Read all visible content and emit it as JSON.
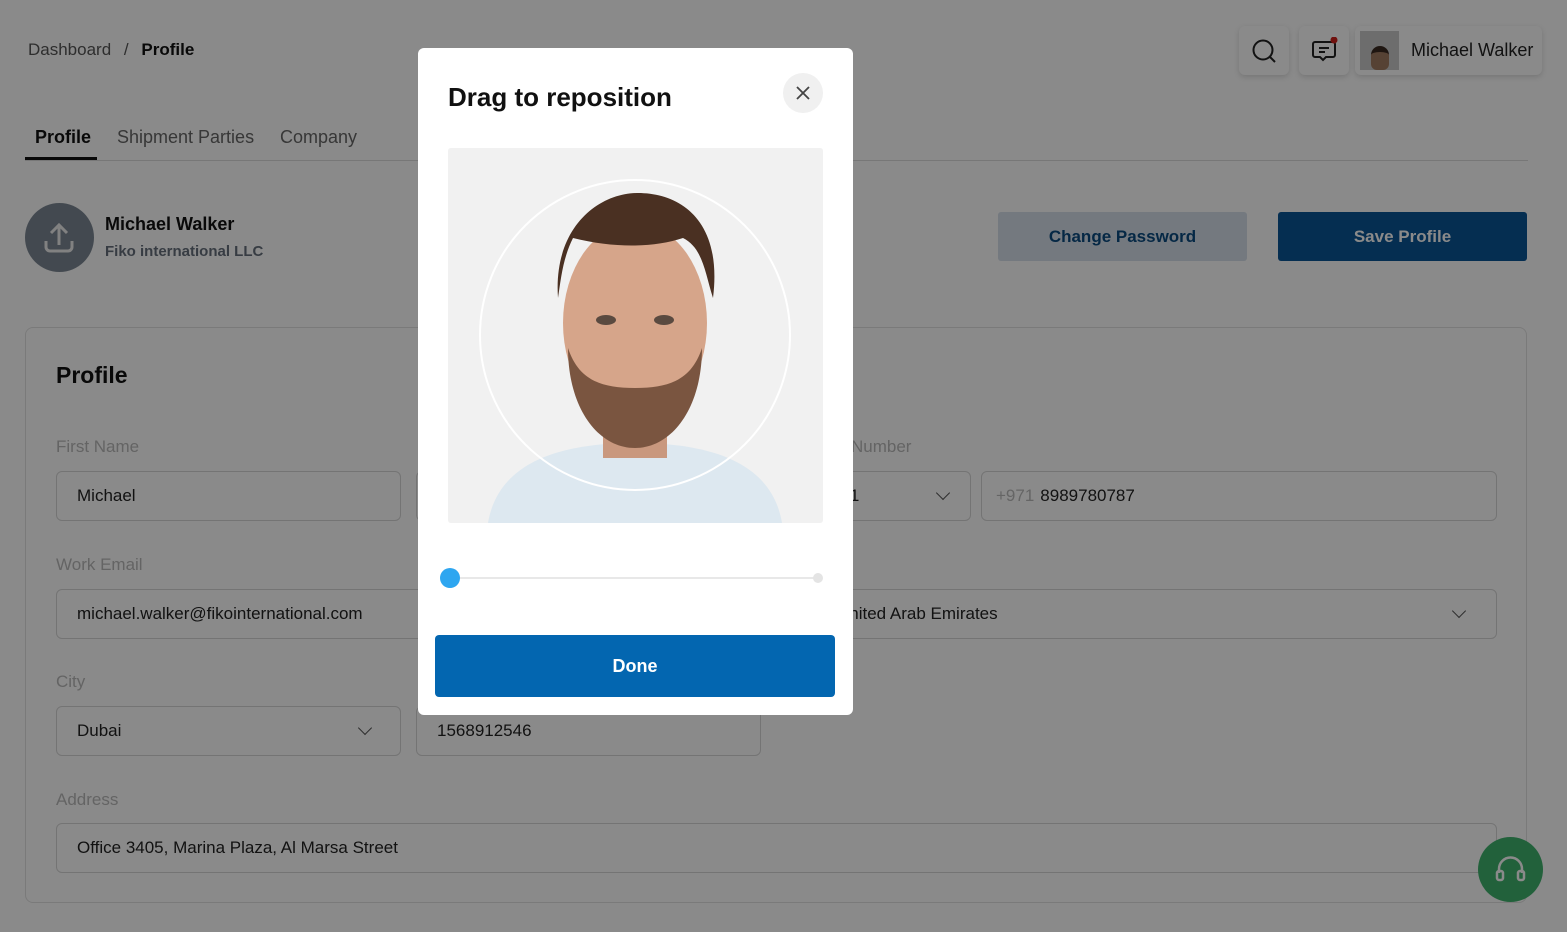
{
  "breadcrumb": {
    "parent": "Dashboard",
    "separator": "/",
    "current": "Profile"
  },
  "header": {
    "user_name": "Michael Walker",
    "notification_dot_color": "#d0201a"
  },
  "tabs": [
    {
      "label": "Profile",
      "active": true
    },
    {
      "label": "Shipment Parties"
    },
    {
      "label": "Company"
    }
  ],
  "profile_summary": {
    "name": "Michael Walker",
    "company": "Fiko international LLC"
  },
  "actions": {
    "change_password": "Change Password",
    "save_profile": "Save Profile"
  },
  "form": {
    "title": "Profile",
    "first_name": {
      "label": "First Name",
      "value": "Michael"
    },
    "phone": {
      "label": "Number",
      "code": "+971",
      "prefix": "+971",
      "value": "8989780787"
    },
    "work_email": {
      "label": "Work Email",
      "value": "michael.walker@fikointernational.com"
    },
    "country": {
      "value": "United Arab Emirates"
    },
    "city": {
      "label": "City",
      "value": "Dubai"
    },
    "po_box": {
      "value": "1568912546"
    },
    "address": {
      "label": "Address",
      "value": "Office 3405, Marina Plaza, Al Marsa Street"
    }
  },
  "modal": {
    "title": "Drag to reposition",
    "done": "Done",
    "zoom_level": 0
  },
  "colors": {
    "primary": "#0366b0",
    "save": "#0b4a80",
    "support": "#2e9e5a",
    "slider": "#2ea6f0"
  }
}
